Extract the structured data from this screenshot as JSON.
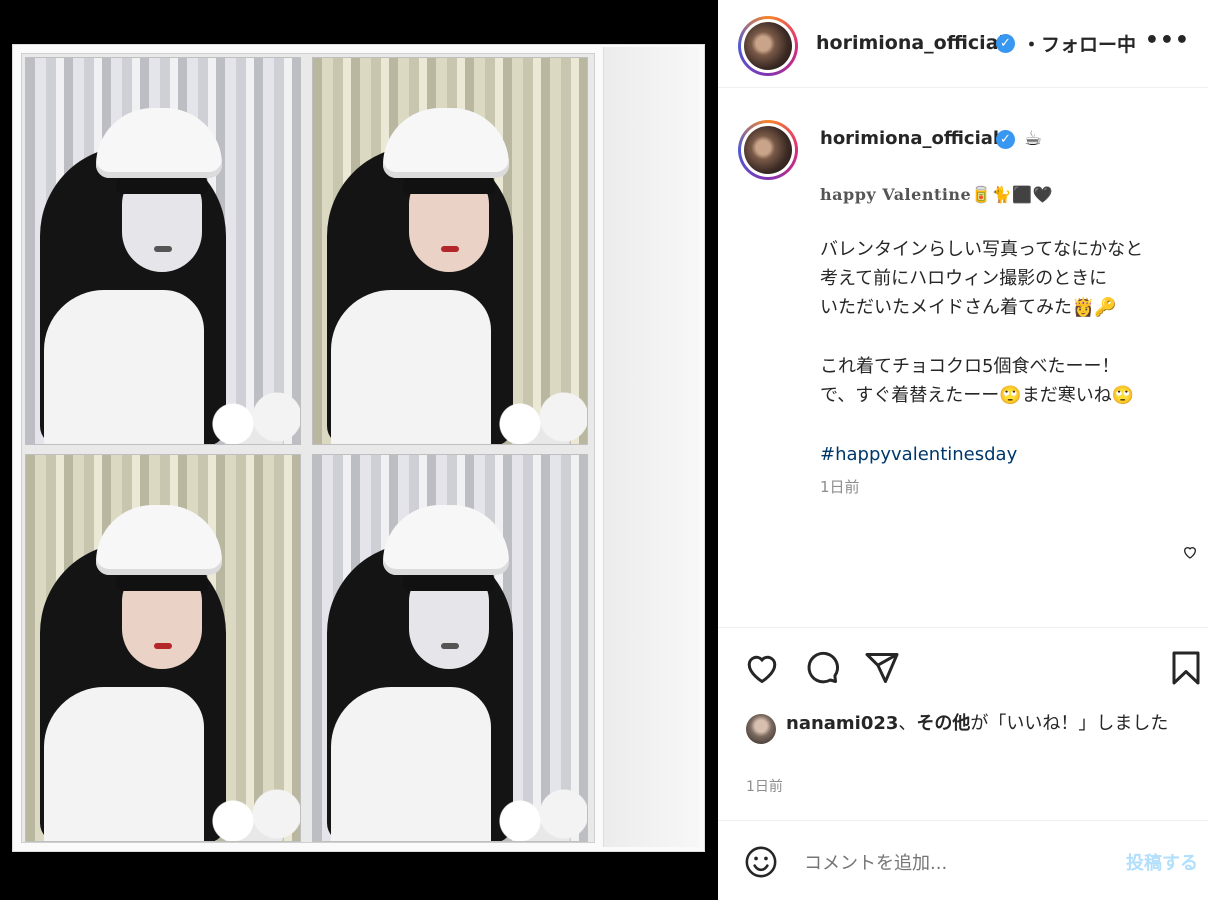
{
  "header": {
    "username": "horimiona_official",
    "follow_status": "・フォロー中",
    "more": "•••"
  },
  "caption": {
    "username": "horimiona_official",
    "emoji": "☕",
    "line1": "happy Valentine🥫🐈⬛🖤",
    "para1": "バレンタインらしい写真ってなにかなと\n考えて前にハロウィン撮影のときに\nいただいたメイドさん着てみた👸🔑",
    "para2": "これ着てチョコクロ5個食べたーー！\nで、すぐ着替えたーー🙄まだ寒いね🙄",
    "hashtag": "#happyvalentinesday",
    "time": "1日前"
  },
  "likes": {
    "user": "nanami023",
    "sep": "、",
    "others": "その他",
    "suffix": "が「いいね！」しました"
  },
  "post_time": "1日前",
  "comment": {
    "placeholder": "コメントを追加...",
    "post_label": "投稿する"
  },
  "colors": {
    "verified": "#3897f0",
    "link": "#00376b",
    "post_disabled": "#b2dffc",
    "muted": "#8e8e8e"
  },
  "icons": [
    "verified-icon",
    "more-icon",
    "heart-icon",
    "comment-icon",
    "share-icon",
    "bookmark-icon",
    "smile-icon"
  ]
}
